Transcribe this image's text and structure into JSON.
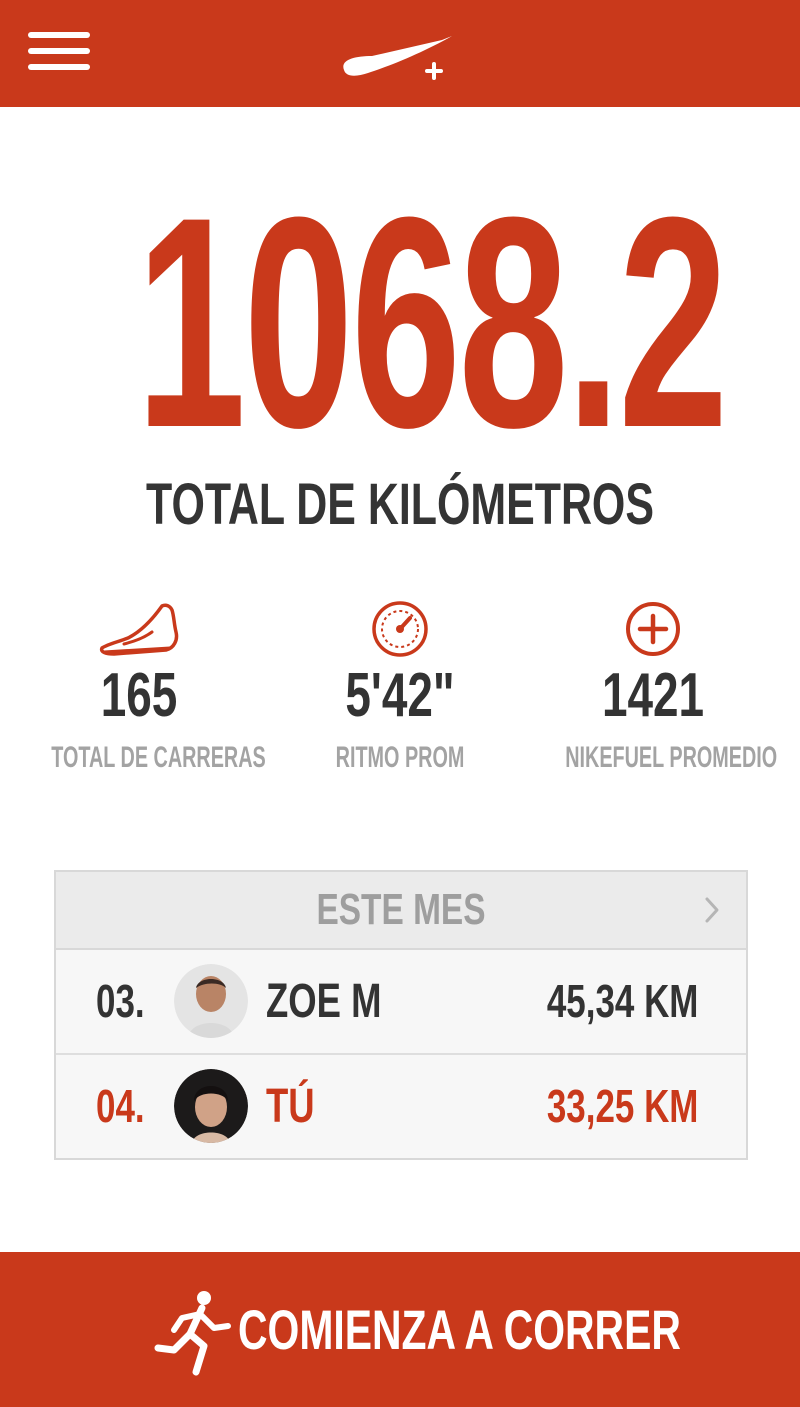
{
  "header": {
    "menu_icon": "hamburger-menu-icon",
    "logo_icon": "nike-plus-swoosh-logo"
  },
  "summary": {
    "total_km": "1068.2",
    "total_km_label": "TOTAL DE KILÓMETROS"
  },
  "stats": [
    {
      "icon": "running-shoe-icon",
      "value": "165",
      "label": "TOTAL DE CARRERAS"
    },
    {
      "icon": "speedometer-icon",
      "value": "5'42\"",
      "label": "RITMO PROM"
    },
    {
      "icon": "nikefuel-plus-icon",
      "value": "1421",
      "label": "NIKEFUEL PROMEDIO"
    }
  ],
  "leaderboard": {
    "title": "ESTE MES",
    "chevron_icon": "chevron-right-icon",
    "rows": [
      {
        "rank": "03.",
        "name": "ZOE M",
        "distance": "45,34 KM",
        "avatar_icon": "avatar-photo",
        "highlight": false
      },
      {
        "rank": "04.",
        "name": "TÚ",
        "distance": "33,25 KM",
        "avatar_icon": "avatar-photo",
        "highlight": true
      }
    ]
  },
  "cta": {
    "icon": "runner-icon",
    "label": "COMIENZA A CORRER"
  },
  "colors": {
    "brand": "#c9391b",
    "text_dark": "#333333",
    "text_muted": "#a3a3a3"
  }
}
